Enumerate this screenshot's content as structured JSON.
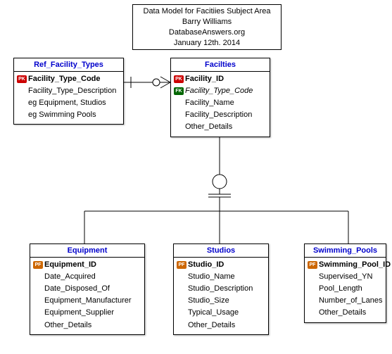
{
  "title": {
    "line1": "Data Model for Facitiies Subject Area",
    "line2": "Barry Williams",
    "line3": "DatabaseAnswers.org",
    "line4": "January 12th. 2014"
  },
  "entities": {
    "ref_facility_types": {
      "name": "Ref_Facility_Types",
      "attrs": [
        {
          "key": "PK",
          "text": "Facility_Type_Code",
          "bold": true
        },
        {
          "key": "",
          "text": "Facility_Type_Description"
        },
        {
          "key": "",
          "text": "eg Equipment, Studios"
        },
        {
          "key": "",
          "text": "eg Swimming Pools"
        }
      ]
    },
    "facilities": {
      "name": "Facilties",
      "attrs": [
        {
          "key": "PK",
          "text": "Facility_ID",
          "bold": true
        },
        {
          "key": "FK",
          "text": "Facility_Type_Code",
          "italic": true
        },
        {
          "key": "",
          "text": "Facility_Name"
        },
        {
          "key": "",
          "text": "Facility_Description"
        },
        {
          "key": "",
          "text": "Other_Details"
        }
      ]
    },
    "equipment": {
      "name": "Equipment",
      "attrs": [
        {
          "key": "PF",
          "text": "Equipment_ID",
          "bold": true
        },
        {
          "key": "",
          "text": "Date_Acquired"
        },
        {
          "key": "",
          "text": "Date_Disposed_Of"
        },
        {
          "key": "",
          "text": "Equipment_Manufacturer"
        },
        {
          "key": "",
          "text": "Equipment_Supplier"
        },
        {
          "key": "",
          "text": "Other_Details"
        }
      ]
    },
    "studios": {
      "name": "Studios",
      "attrs": [
        {
          "key": "PF",
          "text": "Studio_ID",
          "bold": true
        },
        {
          "key": "",
          "text": "Studio_Name"
        },
        {
          "key": "",
          "text": "Studio_Description"
        },
        {
          "key": "",
          "text": "Studio_Size"
        },
        {
          "key": "",
          "text": "Typical_Usage"
        },
        {
          "key": "",
          "text": "Other_Details"
        }
      ]
    },
    "swimming_pools": {
      "name": "Swimming_Pools",
      "attrs": [
        {
          "key": "PF",
          "text": "Swimming_Pool_ID",
          "bold": true
        },
        {
          "key": "",
          "text": "Supervised_YN"
        },
        {
          "key": "",
          "text": "Pool_Length"
        },
        {
          "key": "",
          "text": "Number_of_Lanes"
        },
        {
          "key": "",
          "text": "Other_Details"
        }
      ]
    }
  }
}
